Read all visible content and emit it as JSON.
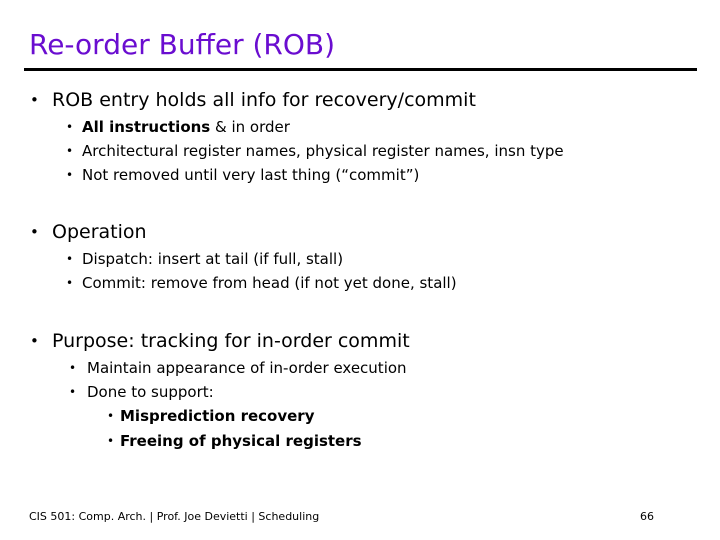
{
  "slide": {
    "title": "Re-order Buffer (ROB)",
    "title_color": "#6a0dd0",
    "background_color": "#ffffff",
    "rule_color": "#000000",
    "bullet_glyph": "•",
    "sections": [
      {
        "heading": "ROB entry holds all info for recovery/commit",
        "items": [
          {
            "bold_lead": "All instructions",
            "rest": " & in order"
          },
          {
            "text": "Architectural register names, physical register names, insn type"
          },
          {
            "text": "Not removed until very last thing (“commit”)"
          }
        ]
      },
      {
        "heading": "Operation",
        "items": [
          {
            "text": "Dispatch: insert at tail  (if full, stall)"
          },
          {
            "text": "Commit: remove from head  (if not yet done, stall)"
          }
        ]
      },
      {
        "heading": "Purpose: tracking for in-order commit",
        "items": [
          {
            "text": "Maintain appearance of in-order execution"
          },
          {
            "text": "Done to support:"
          }
        ],
        "subitems": [
          {
            "text": "Misprediction recovery"
          },
          {
            "text": "Freeing of physical registers"
          }
        ]
      }
    ]
  },
  "footer": {
    "credit": "CIS 501: Comp. Arch.  |  Prof. Joe Devietti  |  Scheduling",
    "page_number": "66"
  }
}
